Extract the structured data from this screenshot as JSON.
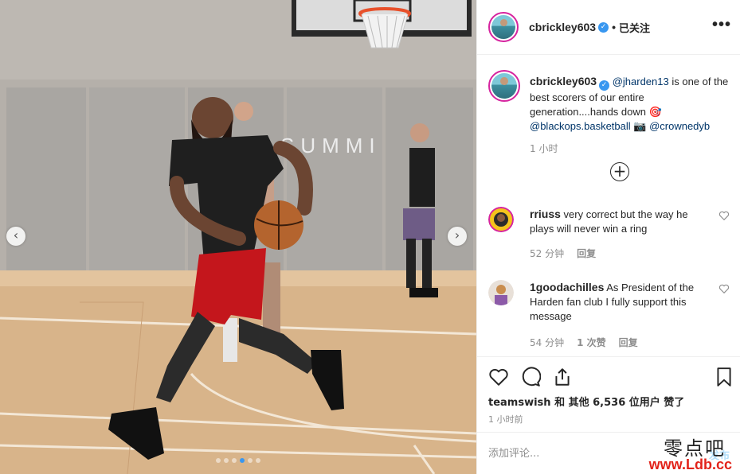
{
  "post": {
    "author": "cbrickley603",
    "follow_status": "已关注",
    "header_separator": "•",
    "more_label": "•••",
    "verified_mark": "✓"
  },
  "caption": {
    "author": "cbrickley603",
    "mention_1": "@jharden13",
    "text": " is one of the best scorers of our entire generation....hands down 🎯 ",
    "mention_2": "@blackops.basketball",
    "camera": " 📷 ",
    "mention_3": "@crownedyb",
    "time": "1 小时",
    "load_more_glyph": "+"
  },
  "photo": {
    "gym_sign": "SUMMI",
    "prev_glyph": "‹",
    "next_glyph": "›",
    "slide_count": 6,
    "active_slide": 3
  },
  "comments": [
    {
      "user": "rriuss",
      "text": "very correct but the way he plays will never win a ring",
      "time": "52 分钟",
      "reply_label": "回复",
      "likes_label": ""
    },
    {
      "user": "1goodachilles",
      "text": "As President of the Harden fan club I fully support this message",
      "time": "54 分钟",
      "likes_label": "1 次赞",
      "reply_label": "回复"
    }
  ],
  "actions": {
    "liked_by": "teamswish",
    "likes_text": " 和 其他 6,536 位用户 赞了",
    "post_time": "1 小时前"
  },
  "add_comment": {
    "placeholder": "添加评论...",
    "post_label": "发布"
  },
  "watermark": {
    "cn": "零点吧",
    "url": "www.Ldb.cc"
  },
  "colors": {
    "accent": "#3897f0",
    "link": "#003569",
    "muted": "#8e8e8e",
    "story_ring": "#d6249f",
    "watermark_red": "#e2231a"
  }
}
